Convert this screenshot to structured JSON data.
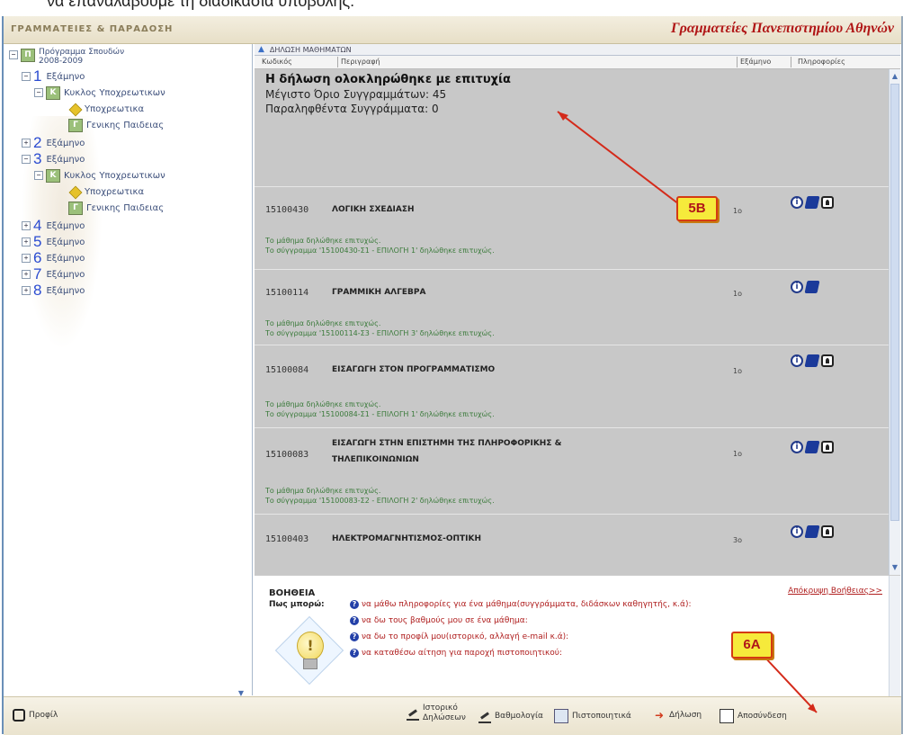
{
  "page": {
    "top_text": "να επαναλάβουμε τη διαδικασία υποβολής:"
  },
  "header": {
    "logo_text": "ΓΡΑΜΜΑΤΕΙΕΣ & ΠΑΡΑΔΟΣΗ",
    "org_title": "Γραμματείες Πανεπιστημίου Αθηνών"
  },
  "tree": {
    "root_label": "Πρόγραμμα Σπουδών 2008-2009",
    "semester_word": "Εξάμηνο",
    "semesters": [
      {
        "num": "1",
        "sign": "−"
      },
      {
        "num": "2",
        "sign": "+"
      },
      {
        "num": "3",
        "sign": "−"
      },
      {
        "num": "4",
        "sign": "+"
      },
      {
        "num": "5",
        "sign": "+"
      },
      {
        "num": "6",
        "sign": "+"
      },
      {
        "num": "7",
        "sign": "+"
      },
      {
        "num": "8",
        "sign": "+"
      }
    ],
    "cycle_label": "Κυκλος Υποχρεωτικων",
    "mandatory_label": "Υποχρεωτικα",
    "general_label": "Γενικης Παιδειας"
  },
  "main": {
    "section_title": "ΔΗΛΩΣΗ ΜΑΘΗΜΑΤΩΝ",
    "columns": {
      "code": "Κωδικός",
      "description": "Περιγραφή",
      "semester": "Εξάμηνο",
      "info": "Πληροφορίες"
    },
    "success_title": "Η δήλωση ολοκληρώθηκε με επιτυχία",
    "max_books": "Μέγιστο Όριο Συγγραμμάτων: 45",
    "received_books": "Παραληφθέντα Συγγράμματα: 0",
    "courses": [
      {
        "code": "15100430",
        "title": "ΛΟΓΙΚΗ ΣΧΕΔΙΑΣΗ",
        "semester": "1ο",
        "msg1": "Το μάθημα δηλώθηκε επιτυχώς.",
        "msg2": "Το σύγγραμμα '15100430-Σ1 - ΕΠΙΛΟΓΗ 1' δηλώθηκε επιτυχώς."
      },
      {
        "code": "15100114",
        "title": "ΓΡΑΜΜΙΚΗ ΑΛΓΕΒΡΑ",
        "semester": "1ο",
        "msg1": "Το μάθημα δηλώθηκε επιτυχώς.",
        "msg2": "Το σύγγραμμα '15100114-Σ3 - ΕΠΙΛΟΓΗ 3' δηλώθηκε επιτυχώς."
      },
      {
        "code": "15100084",
        "title": "ΕΙΣΑΓΩΓΗ ΣΤΟΝ ΠΡΟΓΡΑΜΜΑΤΙΣΜΟ",
        "semester": "1ο",
        "msg1": "Το μάθημα δηλώθηκε επιτυχώς.",
        "msg2": "Το σύγγραμμα '15100084-Σ1 - ΕΠΙΛΟΓΗ 1' δηλώθηκε επιτυχώς."
      },
      {
        "code": "15100083",
        "title_line1": "ΕΙΣΑΓΩΓΗ ΣΤΗΝ ΕΠΙΣΤΗΜΗ ΤΗΣ ΠΛΗΡΟΦΟΡΙΚΗΣ &",
        "title_line2": "ΤΗΛΕΠΙΚΟΙΝΩΝΙΩΝ",
        "semester": "1ο",
        "msg1": "Το μάθημα δηλώθηκε επιτυχώς.",
        "msg2": "Το σύγγραμμα '15100083-Σ2 - ΕΠΙΛΟΓΗ 2' δηλώθηκε επιτυχώς."
      },
      {
        "code": "15100403",
        "title": "ΗΛΕΚΤΡΟΜΑΓΝΗΤΙΣΜΟΣ-ΟΠΤΙΚΗ",
        "semester": "3ο"
      }
    ]
  },
  "help": {
    "title": "ΒΟΗΘΕΙΑ",
    "hide_link": "Απόκρυψη Βοήθειας>>",
    "how_label": "Πως μπορώ:",
    "items": [
      "να μάθω πληροφορίες για ένα μάθημα(συγγράμματα, διδάσκων καθηγητής, κ.ά):",
      "να δω τους βαθμούς μου σε ένα μάθημα:",
      "να δω το προφίλ μου(ιστορικό, αλλαγή e-mail κ.ά):",
      "να καταθέσω αίτηση για παροχή πιστοποιητικού:"
    ]
  },
  "footer": {
    "profile": "Προφίλ",
    "history_line1": "Ιστορικό",
    "history_line2": "Δηλώσεων",
    "grades": "Βαθμολογία",
    "certificates": "Πιστοποιητικά",
    "declaration": "Δήλωση",
    "logout": "Αποσύνδεση"
  },
  "annotations": {
    "callout_5b": "5B",
    "callout_6a": "6A"
  },
  "colors": {
    "accent_red": "#b01515",
    "success_green": "#3a7a3a",
    "callout_yellow": "#f6ea3b",
    "callout_border": "#d43a12"
  }
}
